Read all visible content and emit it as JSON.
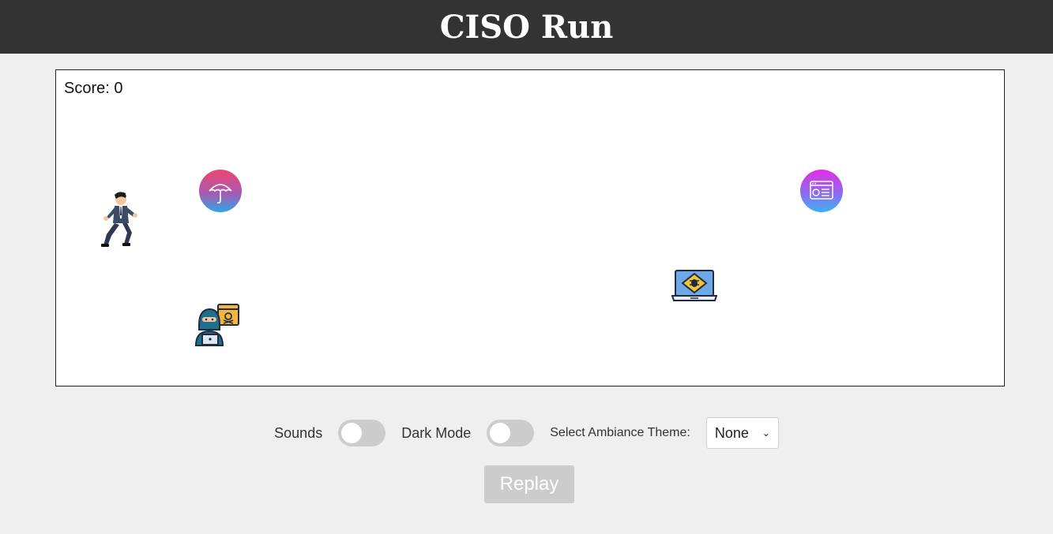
{
  "header": {
    "title": "CISO Run"
  },
  "game": {
    "score_text": "Score: 0",
    "sprites": {
      "player": "ciso-runner-icon",
      "umbrella": "umbrella-shield-icon",
      "webpage": "web-security-icon",
      "bug_laptop": "laptop-bug-icon",
      "hacker": "hacker-icon"
    }
  },
  "controls": {
    "sounds_label": "Sounds",
    "dark_mode_label": "Dark Mode",
    "ambiance_label": "Select Ambiance Theme:",
    "ambiance_selected": "None",
    "replay_label": "Replay"
  },
  "colors": {
    "header_bg": "#333333",
    "page_bg": "#efefef",
    "toggle_off": "#cccccc",
    "replay_disabled": "#cccccc"
  }
}
